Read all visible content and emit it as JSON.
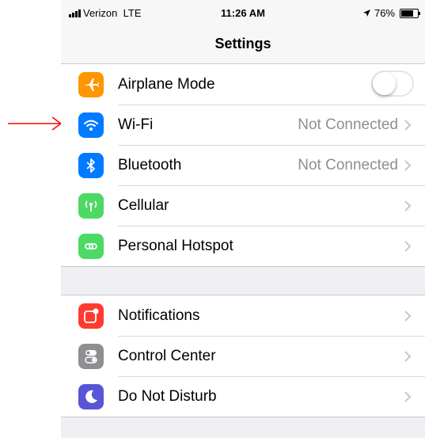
{
  "status_bar": {
    "carrier": "Verizon",
    "network": "LTE",
    "time": "11:26 AM",
    "battery": "76%",
    "battery_level": 0.76
  },
  "nav": {
    "title": "Settings"
  },
  "group1": [
    {
      "label": "Airplane Mode",
      "icon": "airplane-icon",
      "color": "#ff9500",
      "toggle": false
    },
    {
      "label": "Wi-Fi",
      "detail": "Not Connected",
      "icon": "wifi-icon",
      "color": "#007aff"
    },
    {
      "label": "Bluetooth",
      "detail": "Not Connected",
      "icon": "bluetooth-icon",
      "color": "#007aff"
    },
    {
      "label": "Cellular",
      "icon": "cellular-antenna-icon",
      "color": "#4cd964"
    },
    {
      "label": "Personal Hotspot",
      "icon": "hotspot-icon",
      "color": "#4cd964"
    }
  ],
  "group2": [
    {
      "label": "Notifications",
      "icon": "notifications-icon",
      "color": "#ff3b30"
    },
    {
      "label": "Control Center",
      "icon": "control-center-icon",
      "color": "#8e8e93"
    },
    {
      "label": "Do Not Disturb",
      "icon": "moon-icon",
      "color": "#5856d6"
    }
  ],
  "annotation": {
    "color": "#ff0000",
    "icon": "red-arrow"
  }
}
